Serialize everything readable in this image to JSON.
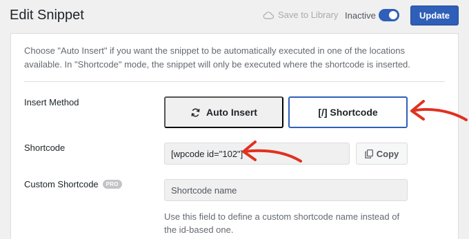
{
  "header": {
    "title": "Edit Snippet",
    "save_to_library": "Save to Library",
    "status": "Inactive",
    "update_label": "Update",
    "toggle_on": true
  },
  "panel": {
    "help_text": "Choose \"Auto Insert\" if you want the snippet to be automatically executed in one of the locations available. In \"Shortcode\" mode, the snippet will only be executed where the shortcode is inserted.",
    "insert_method": {
      "label": "Insert Method",
      "auto_insert_label": "Auto Insert",
      "shortcode_label": "[/] Shortcode",
      "selected": "Shortcode"
    },
    "shortcode": {
      "label": "Shortcode",
      "value": "[wpcode id=\"102\"]",
      "copy_label": "Copy"
    },
    "custom_shortcode": {
      "label": "Custom Shortcode",
      "badge": "PRO",
      "placeholder": "Shortcode name",
      "help": "Use this field to define a custom shortcode name instead of the id-based one."
    }
  },
  "colors": {
    "accent": "#2f5fb8",
    "annotation_arrow": "#e0311f"
  },
  "icons": {
    "save_to_library": "cloud-icon",
    "auto_insert": "refresh-icon",
    "copy": "copy-icon"
  }
}
